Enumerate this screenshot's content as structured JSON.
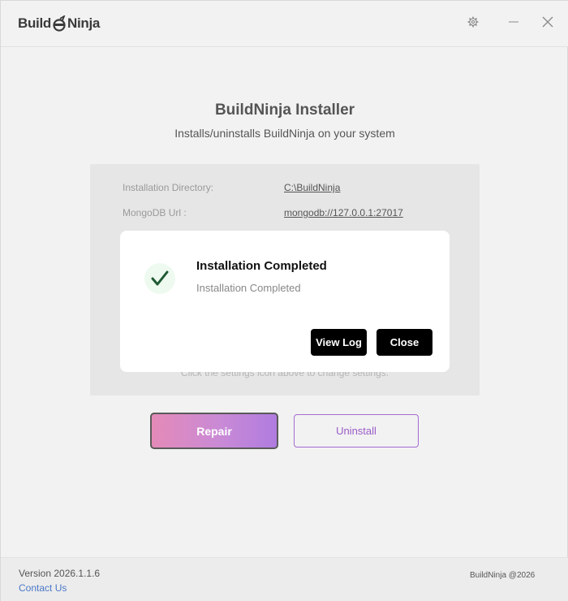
{
  "app": {
    "logo_part1": "Build",
    "logo_part2": "Ninja",
    "logo_icon": "ninja-mark-icon"
  },
  "titlebar": {
    "settings_icon": "gear-icon",
    "minimize_icon": "minimize-icon",
    "close_icon": "close-icon"
  },
  "main": {
    "title": "BuildNinja Installer",
    "subtitle": "Installs/uninstalls BuildNinja on your system",
    "info": {
      "rows": [
        {
          "label": "Installation Directory:",
          "value": "C:\\BuildNinja"
        },
        {
          "label": "MongoDB Url :",
          "value": "mongodb://127.0.0.1:27017"
        }
      ],
      "hint": "Click the settings icon above to change settings."
    },
    "repair_label": "Repair",
    "uninstall_label": "Uninstall"
  },
  "footer": {
    "version": "Version 2026.1.1.6",
    "contact": "Contact Us",
    "copyright": "BuildNinja @2026"
  },
  "modal": {
    "icon": "checkmark-icon",
    "title": "Installation Completed",
    "message": "Installation Completed",
    "view_log_label": "View Log",
    "close_label": "Close"
  },
  "colors": {
    "accent": "#a46bd2",
    "success": "#1f5a34",
    "link": "#4a78c8"
  }
}
